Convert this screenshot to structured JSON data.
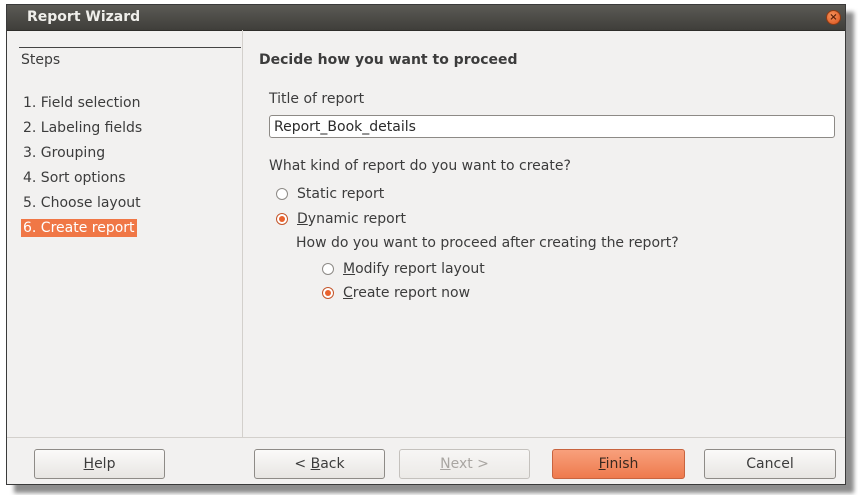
{
  "window": {
    "title": "Report Wizard",
    "close_icon": "close-icon"
  },
  "steps": {
    "header": "Steps",
    "items": [
      {
        "label": "1. Field selection"
      },
      {
        "label": "2. Labeling fields"
      },
      {
        "label": "3. Grouping"
      },
      {
        "label": "4. Sort options"
      },
      {
        "label": "5. Choose layout"
      },
      {
        "label": "6. Create report"
      }
    ],
    "active_index": 5
  },
  "main": {
    "heading": "Decide how you want to proceed",
    "title_label": "Title of report",
    "title_value": "Report_Book_details",
    "kind_question": "What kind of report do you want to create?",
    "static_label": "Static report",
    "dynamic_label_accel": "D",
    "dynamic_label_rest": "ynamic report",
    "proceed_question": "How do you want to proceed after creating the report?",
    "modify_label_accel": "M",
    "modify_label_rest": "odify report layout",
    "create_label_accel": "C",
    "create_label_rest": "reate report now",
    "selected_kind": "Dynamic report",
    "selected_proceed": "Create report now"
  },
  "footer": {
    "help_accel": "H",
    "help_rest": "elp",
    "back_prefix": "< ",
    "back_accel": "B",
    "back_rest": "ack",
    "next_accel": "N",
    "next_rest": "ext >",
    "finish_accel": "F",
    "finish_rest": "inish",
    "cancel_label": "Cancel"
  },
  "colors": {
    "accent": "#f07746",
    "titlebar": "#3f3e3a",
    "window_bg": "#f2f1f0"
  }
}
